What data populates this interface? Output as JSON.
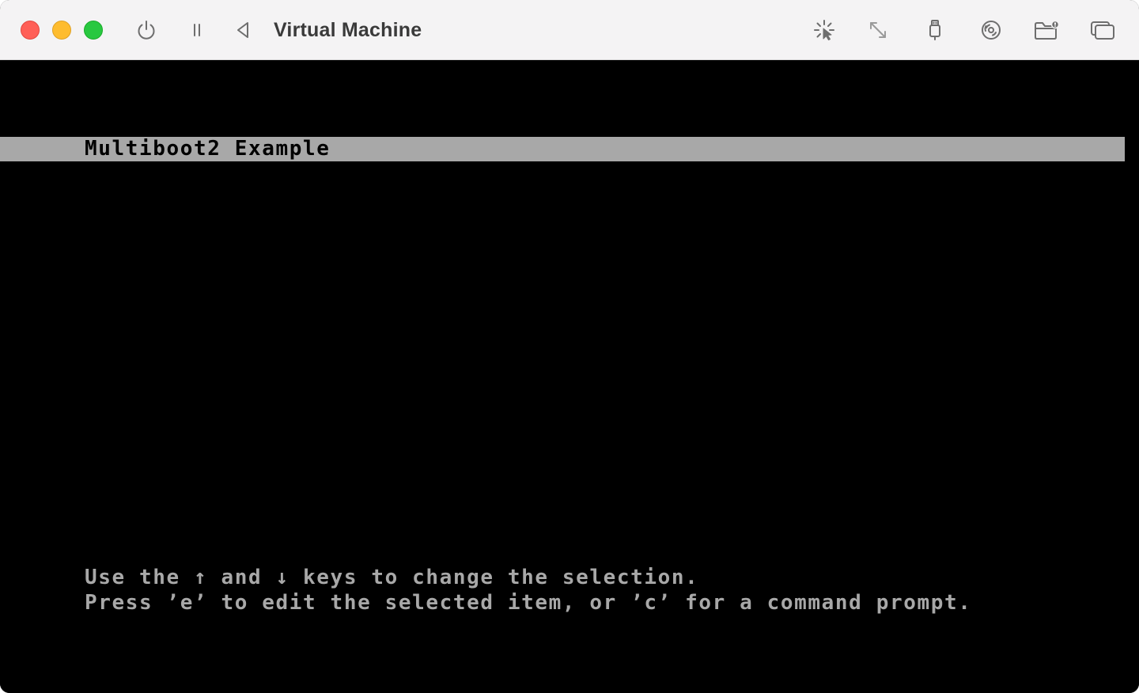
{
  "window": {
    "title": "Virtual Machine"
  },
  "toolbar": {
    "icons": [
      "power-icon",
      "pause-icon",
      "back-triangle-icon",
      "capture-input-icon",
      "resize-icon",
      "usb-icon",
      "cd-dvd-icon",
      "shared-folder-icon",
      "windows-icon"
    ]
  },
  "grub": {
    "entries": [
      {
        "label": "Multiboot2 Example",
        "selected": true
      }
    ],
    "help": {
      "line1": "Use the ↑ and ↓ keys to change the selection.",
      "line2": "Press ’e’ to edit the selected item, or ’c’ for a command prompt."
    }
  },
  "colors": {
    "titlebar_bg": "#f4f3f4",
    "screen_bg": "#000000",
    "highlight_bg": "#a8a8a8",
    "text_light": "#a8a8a8",
    "text_dark": "#000000",
    "traffic_close": "#ff5f57",
    "traffic_minimize": "#febc2e",
    "traffic_zoom": "#28c840"
  }
}
